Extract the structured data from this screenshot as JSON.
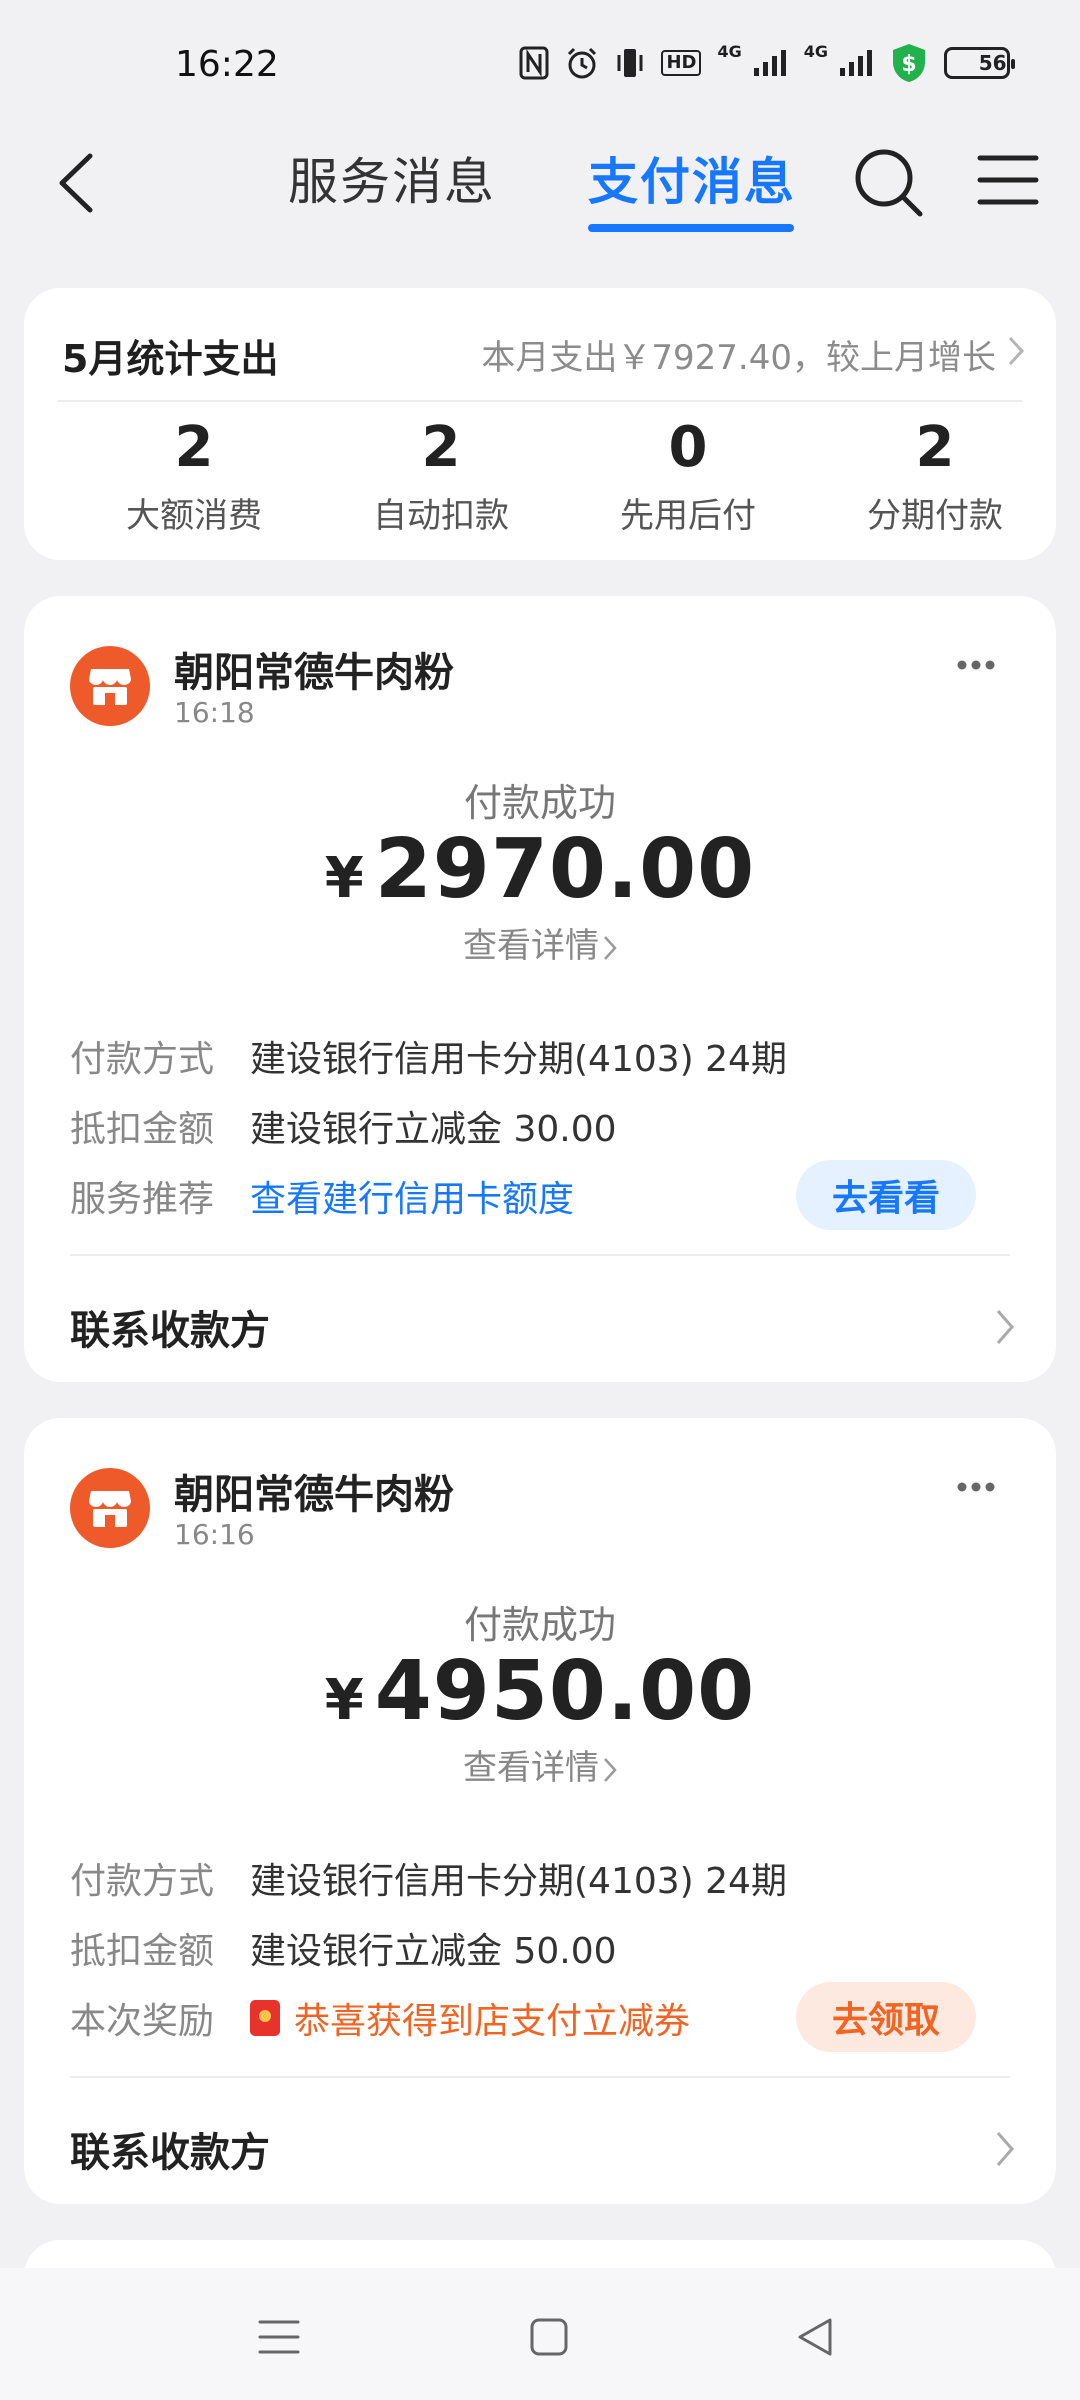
{
  "status_bar": {
    "time": "16:22",
    "hd_label": "HD",
    "net1": "4G",
    "net2": "4G",
    "battery": "56",
    "battery_level": 56
  },
  "topnav": {
    "tabs": [
      {
        "label": "服务消息",
        "active": false
      },
      {
        "label": "支付消息",
        "active": true
      }
    ],
    "accent_color": "#1677ff"
  },
  "summary": {
    "title": "5月统计支出",
    "subtitle": "本月支出￥7927.40，较上月增长",
    "stats": [
      {
        "value": "2",
        "label": "大额消费"
      },
      {
        "value": "2",
        "label": "自动扣款"
      },
      {
        "value": "0",
        "label": "先用后付"
      },
      {
        "value": "2",
        "label": "分期付款"
      }
    ]
  },
  "payments": [
    {
      "merchant": "朝阳常德牛肉粉",
      "time": "16:18",
      "status": "付款成功",
      "currency": "¥",
      "amount": "2970.00",
      "detail_link": "查看详情",
      "rows": [
        {
          "label": "付款方式",
          "value": "建设银行信用卡分期(4103) 24期"
        },
        {
          "label": "抵扣金额",
          "value": "建设银行立减金 30.00"
        },
        {
          "label": "服务推荐",
          "value": "查看建行信用卡额度",
          "button": "去看看"
        }
      ],
      "contact": "联系收款方"
    },
    {
      "merchant": "朝阳常德牛肉粉",
      "time": "16:16",
      "status": "付款成功",
      "currency": "¥",
      "amount": "4950.00",
      "detail_link": "查看详情",
      "rows": [
        {
          "label": "付款方式",
          "value": "建设银行信用卡分期(4103) 24期"
        },
        {
          "label": "抵扣金额",
          "value": "建设银行立减金 50.00"
        },
        {
          "label": "本次奖励",
          "value": "恭喜获得到店支付立减券",
          "button": "去领取"
        }
      ],
      "contact": "联系收款方"
    }
  ],
  "colors": {
    "merchant_logo": "#ef5a2a",
    "reward_orange": "#f06424",
    "background": "#f1f1f3"
  }
}
